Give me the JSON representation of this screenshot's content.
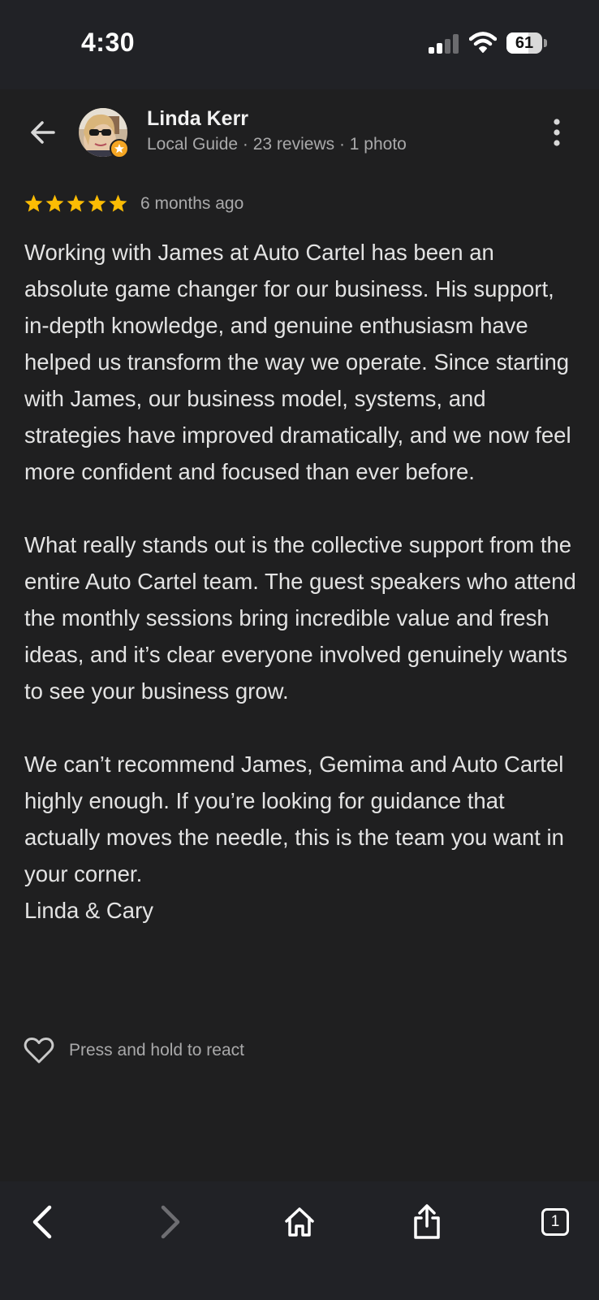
{
  "status_bar": {
    "time": "4:30",
    "battery_level": "61",
    "battery_fraction": 0.61,
    "signal_bars_active": 2,
    "signal_bars_total": 4
  },
  "review": {
    "reviewer_name": "Linda Kerr",
    "reviewer_meta": "Local Guide · 23 reviews · 1 photo",
    "rating": 5,
    "rating_max": 5,
    "date": "6 months ago",
    "paragraphs": [
      "Working with James at Auto Cartel has been an absolute game changer for our business. His support, in-depth knowledge, and genuine enthusiasm have helped us transform the way we operate. Since starting with James, our business model, systems, and strategies have improved dramatically, and we now feel more confident and focused than ever before.",
      "What really stands out is the collective support from the entire Auto Cartel team. The guest speakers who attend the monthly sessions bring incredible value and fresh ideas, and it’s clear everyone involved genuinely wants to see your business grow.",
      "We can’t recommend James, Gemima and Auto Cartel highly enough. If you’re looking for guidance that actually moves the needle, this is the team you want in your corner.",
      "Linda & Cary"
    ],
    "react_label": "Press and hold to react"
  },
  "toolbar": {
    "tab_count": "1"
  },
  "icons": {
    "back": "arrow-left-icon",
    "more": "more-vert-icon",
    "star": "star-icon",
    "heart": "heart-outline-icon",
    "browser_back": "chevron-left-icon",
    "browser_forward": "chevron-right-icon",
    "home": "home-icon",
    "share": "share-icon",
    "tabs": "tabs-icon"
  },
  "colors": {
    "background": "#1f1f20",
    "bars": "#212226",
    "star": "#fbbc04",
    "text": "#e3e3e3",
    "secondary_text": "#a9a9aa",
    "badge": "#f5a623"
  }
}
